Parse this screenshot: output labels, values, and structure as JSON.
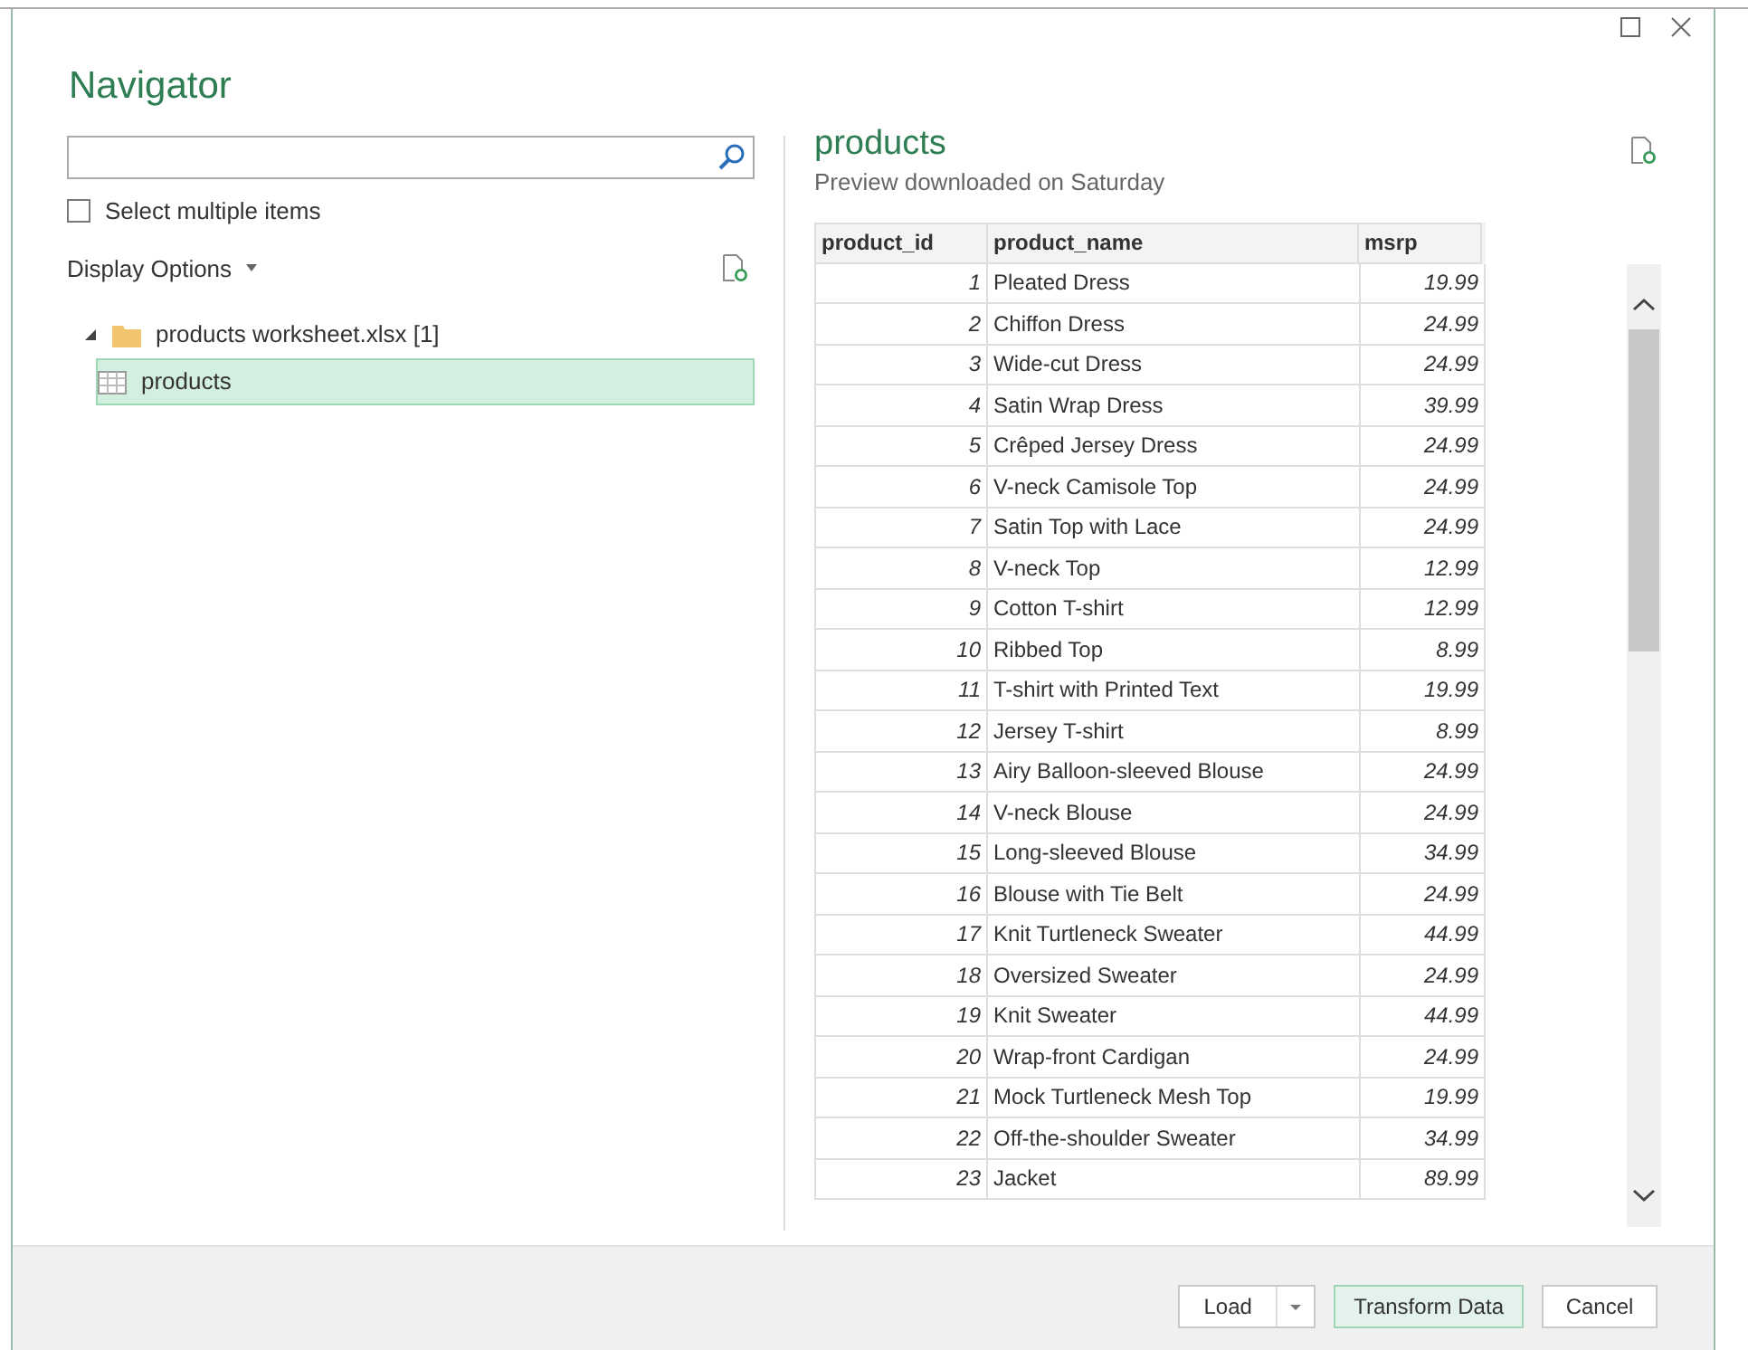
{
  "window": {
    "title": "Navigator"
  },
  "search": {
    "kind": "search"
  },
  "select_multiple": {
    "label": "Select multiple items",
    "checked": false
  },
  "display_options": {
    "label": "Display Options"
  },
  "tree": [
    {
      "label": "products worksheet.xlsx [1]",
      "kind": "folder",
      "expanded": true,
      "selected": false,
      "children": [
        {
          "label": "products",
          "kind": "table",
          "selected": true
        }
      ]
    }
  ],
  "preview": {
    "title": "products",
    "subtitle": "Preview downloaded on Saturday",
    "columns": [
      "product_id",
      "product_name",
      "msrp"
    ],
    "rows": [
      [
        "1",
        "Pleated Dress",
        "19.99"
      ],
      [
        "2",
        "Chiffon Dress",
        "24.99"
      ],
      [
        "3",
        "Wide-cut Dress",
        "24.99"
      ],
      [
        "4",
        "Satin Wrap Dress",
        "39.99"
      ],
      [
        "5",
        "Crêped Jersey Dress",
        "24.99"
      ],
      [
        "6",
        "V-neck Camisole Top",
        "24.99"
      ],
      [
        "7",
        "Satin Top with Lace",
        "24.99"
      ],
      [
        "8",
        "V-neck Top",
        "12.99"
      ],
      [
        "9",
        "Cotton T-shirt",
        "12.99"
      ],
      [
        "10",
        "Ribbed Top",
        "8.99"
      ],
      [
        "11",
        "T-shirt with Printed Text",
        "19.99"
      ],
      [
        "12",
        "Jersey T-shirt",
        "8.99"
      ],
      [
        "13",
        "Airy Balloon-sleeved Blouse",
        "24.99"
      ],
      [
        "14",
        "V-neck Blouse",
        "24.99"
      ],
      [
        "15",
        "Long-sleeved Blouse",
        "34.99"
      ],
      [
        "16",
        "Blouse with Tie Belt",
        "24.99"
      ],
      [
        "17",
        "Knit Turtleneck Sweater",
        "44.99"
      ],
      [
        "18",
        "Oversized Sweater",
        "24.99"
      ],
      [
        "19",
        "Knit Sweater",
        "44.99"
      ],
      [
        "20",
        "Wrap-front Cardigan",
        "24.99"
      ],
      [
        "21",
        "Mock Turtleneck Mesh Top",
        "19.99"
      ],
      [
        "22",
        "Off-the-shoulder Sweater",
        "34.99"
      ],
      [
        "23",
        "Jacket",
        "89.99"
      ]
    ]
  },
  "buttons": [
    {
      "label": "Load",
      "kind": "split",
      "highlighted": false
    },
    {
      "label": "Transform Data",
      "kind": "plain",
      "highlighted": true
    },
    {
      "label": "Cancel",
      "kind": "plain",
      "highlighted": false
    }
  ]
}
